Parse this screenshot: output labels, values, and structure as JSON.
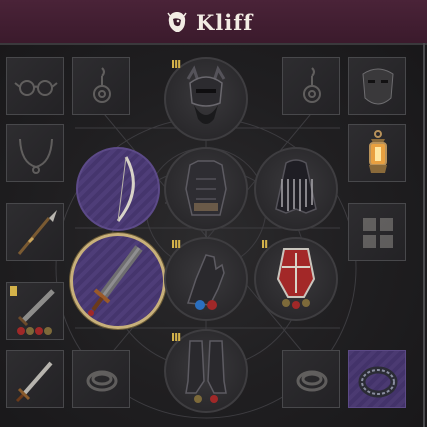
{
  "header": {
    "character_name": "Kliff",
    "character_icon": "lion-head-icon"
  },
  "colors": {
    "header_bg": "#3b1a2c",
    "panel_bg": "#1c1b1d",
    "slot_border": "#48484b",
    "rare_purple": "#4b3a72",
    "selected_gold": "#c8b07a",
    "tier_gold": "#d4b24a"
  },
  "equipment": {
    "helmet": {
      "icon": "horned-helmet-icon",
      "tier": "III"
    },
    "chest": {
      "icon": "chest-armor-icon"
    },
    "cloak": {
      "icon": "cloak-icon"
    },
    "gloves": {
      "icon": "gauntlet-icon",
      "tier": "III"
    },
    "shield": {
      "icon": "red-shield-icon",
      "tier": "II"
    },
    "boots": {
      "icon": "greaves-boots-icon",
      "tier": "III"
    },
    "bow": {
      "icon": "bow-icon",
      "rarity": "rare"
    },
    "sword": {
      "icon": "greatsword-icon",
      "rarity": "rare",
      "selected": true
    }
  },
  "left_slots": [
    {
      "icon": "glasses-icon",
      "empty": true
    },
    {
      "icon": "earring-icon",
      "empty": true
    },
    {
      "icon": "necklace-icon",
      "empty": true
    },
    {
      "icon": "spear-icon",
      "empty": false
    },
    {
      "icon": "shortsword-icon",
      "empty": false,
      "tier": "I"
    },
    {
      "icon": "dagger-icon",
      "empty": false
    },
    {
      "icon": "ring-icon",
      "empty": true
    }
  ],
  "right_slots": [
    {
      "icon": "earring-icon",
      "empty": true
    },
    {
      "icon": "mask-icon",
      "empty": false
    },
    {
      "icon": "lantern-icon",
      "empty": false
    },
    {
      "icon": "backpack-icon",
      "empty": true
    },
    {
      "icon": "ring-icon",
      "empty": true
    },
    {
      "icon": "ornate-ring-icon",
      "empty": false,
      "rarity": "rare"
    }
  ]
}
